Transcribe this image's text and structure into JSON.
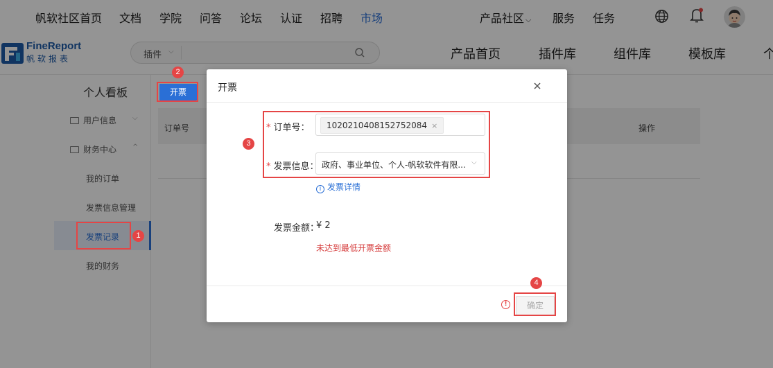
{
  "top_nav": {
    "items": [
      "帆软社区首页",
      "文档",
      "学院",
      "问答",
      "论坛",
      "认证",
      "招聘",
      "市场"
    ],
    "active": "市场",
    "right_items": [
      "产品社区",
      "服务",
      "任务"
    ]
  },
  "logo": {
    "en": "FineReport",
    "cn": "帆软报表"
  },
  "search": {
    "category": "插件",
    "placeholder": ""
  },
  "product_nav": [
    "产品首页",
    "插件库",
    "组件库",
    "模板库",
    "个"
  ],
  "sidebar": {
    "title": "个人看板",
    "groups": [
      {
        "label": "用户信息"
      },
      {
        "label": "财务中心"
      }
    ],
    "items": [
      "我的订单",
      "发票信息管理",
      "发票记录",
      "我的财务"
    ],
    "active_item": "发票记录"
  },
  "main": {
    "invoice_button": "开票",
    "table_headers": [
      "订单号",
      "操作"
    ]
  },
  "dialog": {
    "title": "开票",
    "order_label": "订单号：",
    "order_tag": "1020210408152752084",
    "order_tag_remove": "×",
    "invoice_info_label": "发票信息：",
    "invoice_info_value": "政府、事业单位、个人-帆软软件有限...",
    "detail_link": "发票详情",
    "amount_label": "发票金额：",
    "amount_value": "¥ 2",
    "warning": "未达到最低开票金额",
    "confirm_button": "确定"
  },
  "annotations": [
    "1",
    "2",
    "3",
    "4"
  ],
  "colors": {
    "accent": "#2a6fd6",
    "annotation_red": "#e54545",
    "warning": "#d63e3e"
  }
}
